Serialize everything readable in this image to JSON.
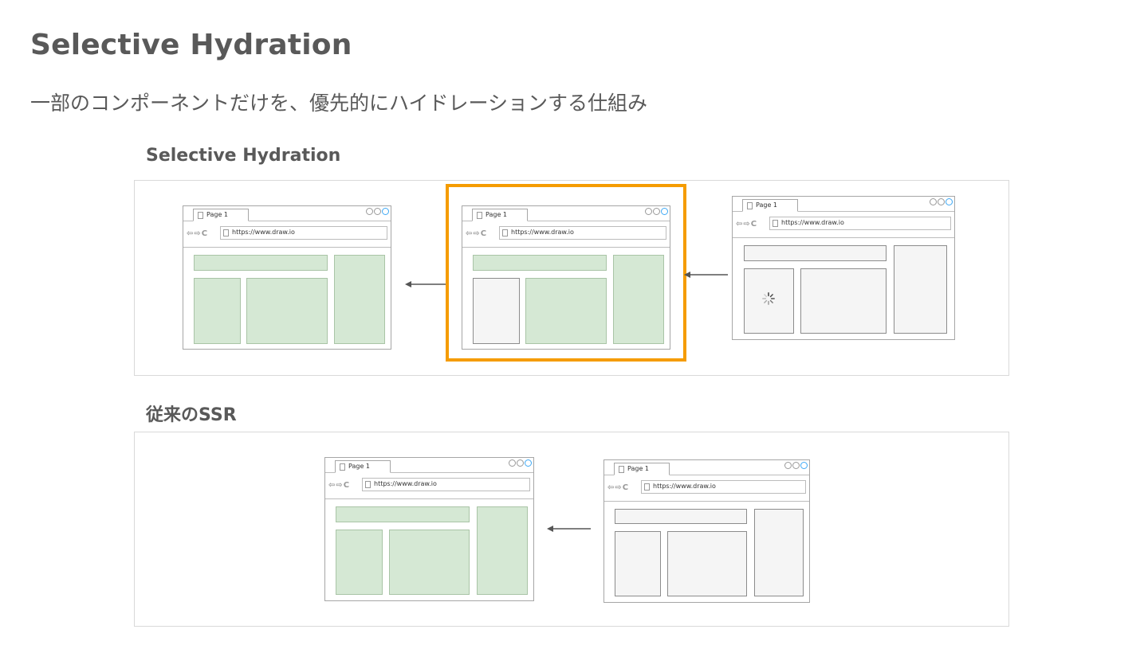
{
  "slide": {
    "title": "Selective Hydration",
    "subtitle": "一部のコンポーネントだけを、優先的にハイドレーションする仕組み"
  },
  "sections": {
    "selective_label": "Selective Hydration",
    "traditional_label": "従来のSSR"
  },
  "browser": {
    "tab_label": "Page 1",
    "url": "https://www.draw.io",
    "nav_icons": "⇦⇨C"
  },
  "colors": {
    "hydrated": "#d5e8d4",
    "not_hydrated": "#f5f5f5",
    "highlight": "#f59c00"
  },
  "diagram": {
    "selective_flow": [
      "fully hydrated",
      "partially hydrated (highlighted)",
      "not hydrated, loading"
    ],
    "traditional_flow": [
      "fully hydrated",
      "not hydrated"
    ]
  }
}
